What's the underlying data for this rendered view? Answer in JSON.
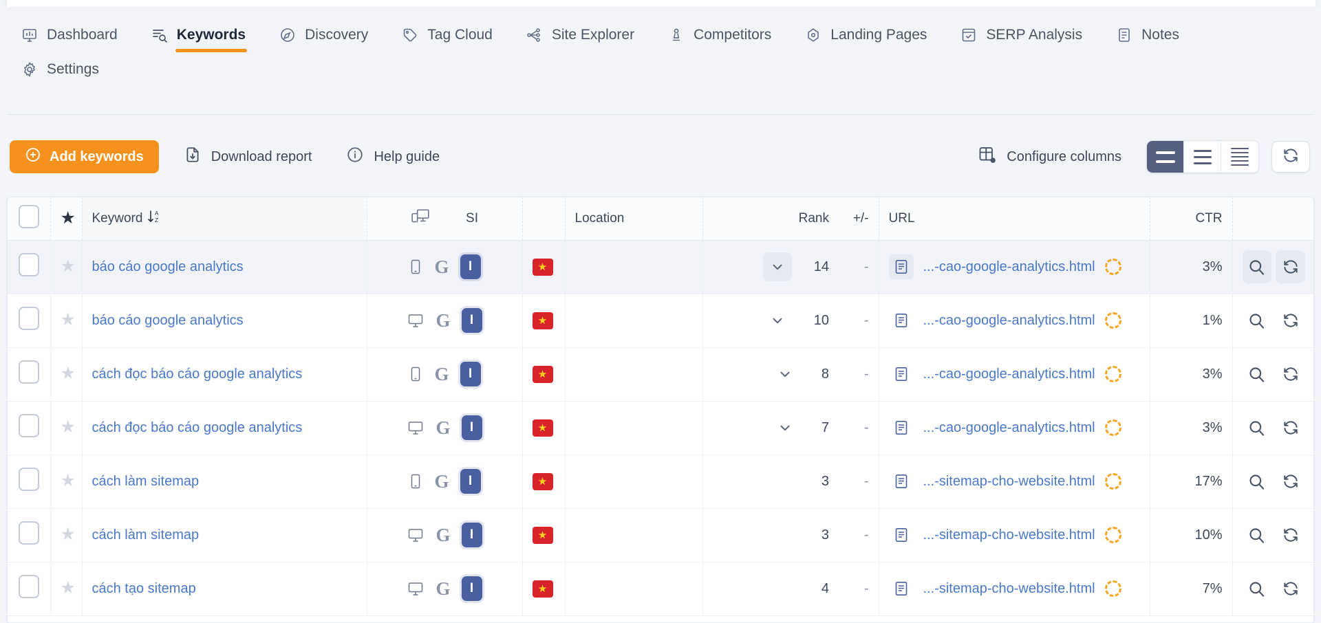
{
  "nav": {
    "rows": [
      [
        {
          "label": "Dashboard",
          "icon": "dashboard-monitor-icon",
          "active": false
        },
        {
          "label": "Keywords",
          "icon": "keywords-list-search-icon",
          "active": true
        },
        {
          "label": "Discovery",
          "icon": "discovery-compass-icon",
          "active": false
        },
        {
          "label": "Tag Cloud",
          "icon": "tag-cloud-icon",
          "active": false
        },
        {
          "label": "Site Explorer",
          "icon": "site-explorer-nodes-icon",
          "active": false
        },
        {
          "label": "Competitors",
          "icon": "competitors-chess-pawn-icon",
          "active": false
        },
        {
          "label": "Landing Pages",
          "icon": "landing-pages-target-icon",
          "active": false
        },
        {
          "label": "SERP Analysis",
          "icon": "serp-analysis-window-check-icon",
          "active": false
        },
        {
          "label": "Notes",
          "icon": "notes-document-icon",
          "active": false
        }
      ],
      [
        {
          "label": "Settings",
          "icon": "settings-gear-icon",
          "active": false
        }
      ]
    ]
  },
  "toolbar": {
    "add_keywords_label": "Add keywords",
    "download_report_label": "Download report",
    "help_guide_label": "Help guide",
    "configure_columns_label": "Configure columns",
    "density_options": [
      {
        "name": "comfortable",
        "lines": 2,
        "active": true
      },
      {
        "name": "normal",
        "lines": 3,
        "active": false
      },
      {
        "name": "compact",
        "lines": 5,
        "active": false
      }
    ],
    "refresh_label": "refresh-icon",
    "accent_color": "#f5921e"
  },
  "table": {
    "headers": {
      "select_all": "select-all-checkbox",
      "star": "★",
      "keyword": "Keyword",
      "keyword_sort": "↓",
      "keyword_sort_az": "A\nZ",
      "si": "SI",
      "location": "Location",
      "rank": "Rank",
      "delta": "+/-",
      "url": "URL",
      "ctr": "CTR"
    },
    "rows": [
      {
        "keyword": "báo cáo google analytics",
        "device": "mobile",
        "engine": "G",
        "badge": "I",
        "flag": "★",
        "location": "",
        "has_chevron": true,
        "rank": "14",
        "delta": "-",
        "url": "...-cao-google-analytics.html",
        "ctr": "3%",
        "highlighted": true
      },
      {
        "keyword": "báo cáo google analytics",
        "device": "desktop",
        "engine": "G",
        "badge": "I",
        "flag": "★",
        "location": "",
        "has_chevron": true,
        "rank": "10",
        "delta": "-",
        "url": "...-cao-google-analytics.html",
        "ctr": "1%",
        "highlighted": false
      },
      {
        "keyword": "cách đọc báo cáo google analytics",
        "device": "mobile",
        "engine": "G",
        "badge": "I",
        "flag": "★",
        "location": "",
        "has_chevron": true,
        "rank": "8",
        "delta": "-",
        "url": "...-cao-google-analytics.html",
        "ctr": "3%",
        "highlighted": false
      },
      {
        "keyword": "cách đọc báo cáo google analytics",
        "device": "desktop",
        "engine": "G",
        "badge": "I",
        "flag": "★",
        "location": "",
        "has_chevron": true,
        "rank": "7",
        "delta": "-",
        "url": "...-cao-google-analytics.html",
        "ctr": "3%",
        "highlighted": false
      },
      {
        "keyword": "cách làm sitemap",
        "device": "mobile",
        "engine": "G",
        "badge": "I",
        "flag": "★",
        "location": "",
        "has_chevron": false,
        "rank": "3",
        "delta": "-",
        "url": "...-sitemap-cho-website.html",
        "ctr": "17%",
        "highlighted": false
      },
      {
        "keyword": "cách làm sitemap",
        "device": "desktop",
        "engine": "G",
        "badge": "I",
        "flag": "★",
        "location": "",
        "has_chevron": false,
        "rank": "3",
        "delta": "-",
        "url": "...-sitemap-cho-website.html",
        "ctr": "10%",
        "highlighted": false
      },
      {
        "keyword": "cách tạo sitemap",
        "device": "desktop",
        "engine": "G",
        "badge": "I",
        "flag": "★",
        "location": "",
        "has_chevron": false,
        "rank": "4",
        "delta": "-",
        "url": "...-sitemap-cho-website.html",
        "ctr": "7%",
        "highlighted": false
      }
    ]
  }
}
